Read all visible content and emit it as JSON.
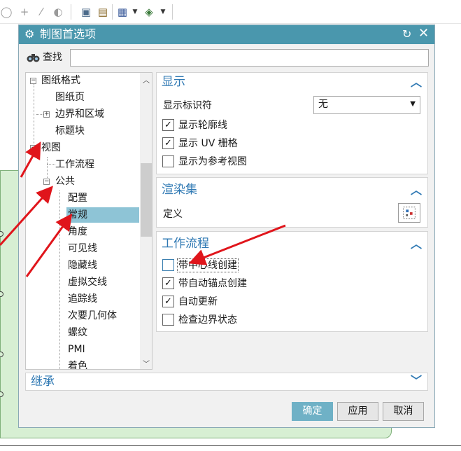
{
  "dialog": {
    "title": "制图首选项",
    "find_label": "查找",
    "find_value": ""
  },
  "tree": {
    "items": [
      {
        "label": "图纸格式"
      },
      {
        "label": "图纸页"
      },
      {
        "label": "边界和区域"
      },
      {
        "label": "标题块"
      },
      {
        "label": "视图"
      },
      {
        "label": "工作流程"
      },
      {
        "label": "公共"
      },
      {
        "label": "配置"
      },
      {
        "label": "常规"
      },
      {
        "label": "角度"
      },
      {
        "label": "可见线"
      },
      {
        "label": "隐藏线"
      },
      {
        "label": "虚拟交线"
      },
      {
        "label": "追踪线"
      },
      {
        "label": "次要几何体"
      },
      {
        "label": "螺纹"
      },
      {
        "label": "PMI"
      },
      {
        "label": "着色"
      }
    ]
  },
  "display_panel": {
    "title": "显示",
    "identifier_label": "显示标识符",
    "identifier_value": "无",
    "checks": [
      {
        "label": "显示轮廓线",
        "checked": "✓"
      },
      {
        "label": "显示 UV 栅格",
        "checked": "✓"
      },
      {
        "label": "显示为参考视图",
        "checked": ""
      }
    ]
  },
  "render_panel": {
    "title": "渲染集",
    "define_label": "定义"
  },
  "workflow_panel": {
    "title": "工作流程",
    "checks": [
      {
        "label": "带中心线创建",
        "checked": ""
      },
      {
        "label": "带自动锚点创建",
        "checked": "✓"
      },
      {
        "label": "自动更新",
        "checked": "✓"
      },
      {
        "label": "检查边界状态",
        "checked": ""
      }
    ]
  },
  "inherit_panel": {
    "title": "继承"
  },
  "buttons": {
    "ok": "确定",
    "apply": "应用",
    "cancel": "取消"
  },
  "colors": {
    "titlebar": "#4a97ad",
    "accent": "#2e78b3",
    "selected": "#8ec4d6",
    "annotation_arrow": "#e0151b"
  }
}
